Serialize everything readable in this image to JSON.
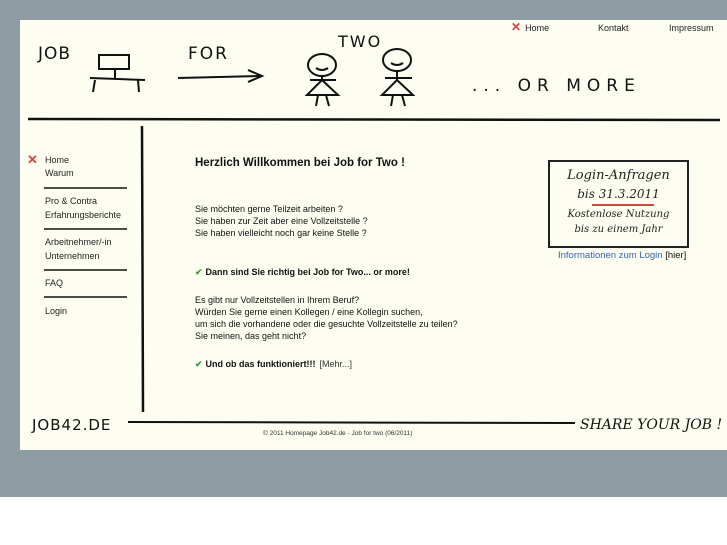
{
  "header": {
    "sketch_words": [
      "JOB",
      "FOR",
      "TWO",
      "... OR MORE"
    ]
  },
  "top_nav": {
    "items": [
      {
        "label": "Home",
        "active": true
      },
      {
        "label": "Kontakt"
      },
      {
        "label": "Impressum"
      }
    ]
  },
  "left_menu": {
    "groups": [
      [
        "Home",
        "Warum"
      ],
      [
        "Pro & Contra",
        "Erfahrungsberichte"
      ],
      [
        "Arbeitnehmer/-in",
        "Unternehmen"
      ],
      [
        "FAQ"
      ],
      [
        "Login"
      ]
    ]
  },
  "main": {
    "title": "Herzlich Willkommen bei Job for Two !",
    "intro_lines": [
      "Sie möchten gerne Teilzeit arbeiten ?",
      "Sie haben zur Zeit aber eine Vollzeitstelle ?",
      "Sie haben vielleicht noch gar keine Stelle ?"
    ],
    "callout1": "Dann sind Sie richtig bei Job for Two... or more!",
    "body_lines": [
      "Es gibt nur Vollzeitstellen in Ihrem Beruf?",
      "Würden Sie gerne einen Kollegen / eine Kollegin suchen,",
      "um sich die vorhandene oder die gesuchte Vollzeitstelle zu teilen?",
      "Sie meinen, das geht nicht?"
    ],
    "callout2": "Und ob das funktioniert!!!",
    "more_link": "[Mehr...]"
  },
  "login_box": {
    "line1": "Login-Anfragen",
    "line2": "bis 31.3.2011",
    "line3": "Kostenlose Nutzung",
    "line4": "bis zu einem Jahr"
  },
  "info_link": {
    "label": "Informationen zum Login",
    "suffix": "[hier]"
  },
  "footer": {
    "left_logo": "JOB42.DE",
    "right_slogan": "SHARE YOUR JOB !",
    "copyright": "© 2011 Homepage Job42.de - Job for two (06/2011)"
  },
  "colors": {
    "accent_red": "#d9443a",
    "check_green": "#3f9b3f",
    "link_blue": "#3366aa",
    "page_bg": "#fdfdf2",
    "frame_grey": "#8f9ca3"
  }
}
